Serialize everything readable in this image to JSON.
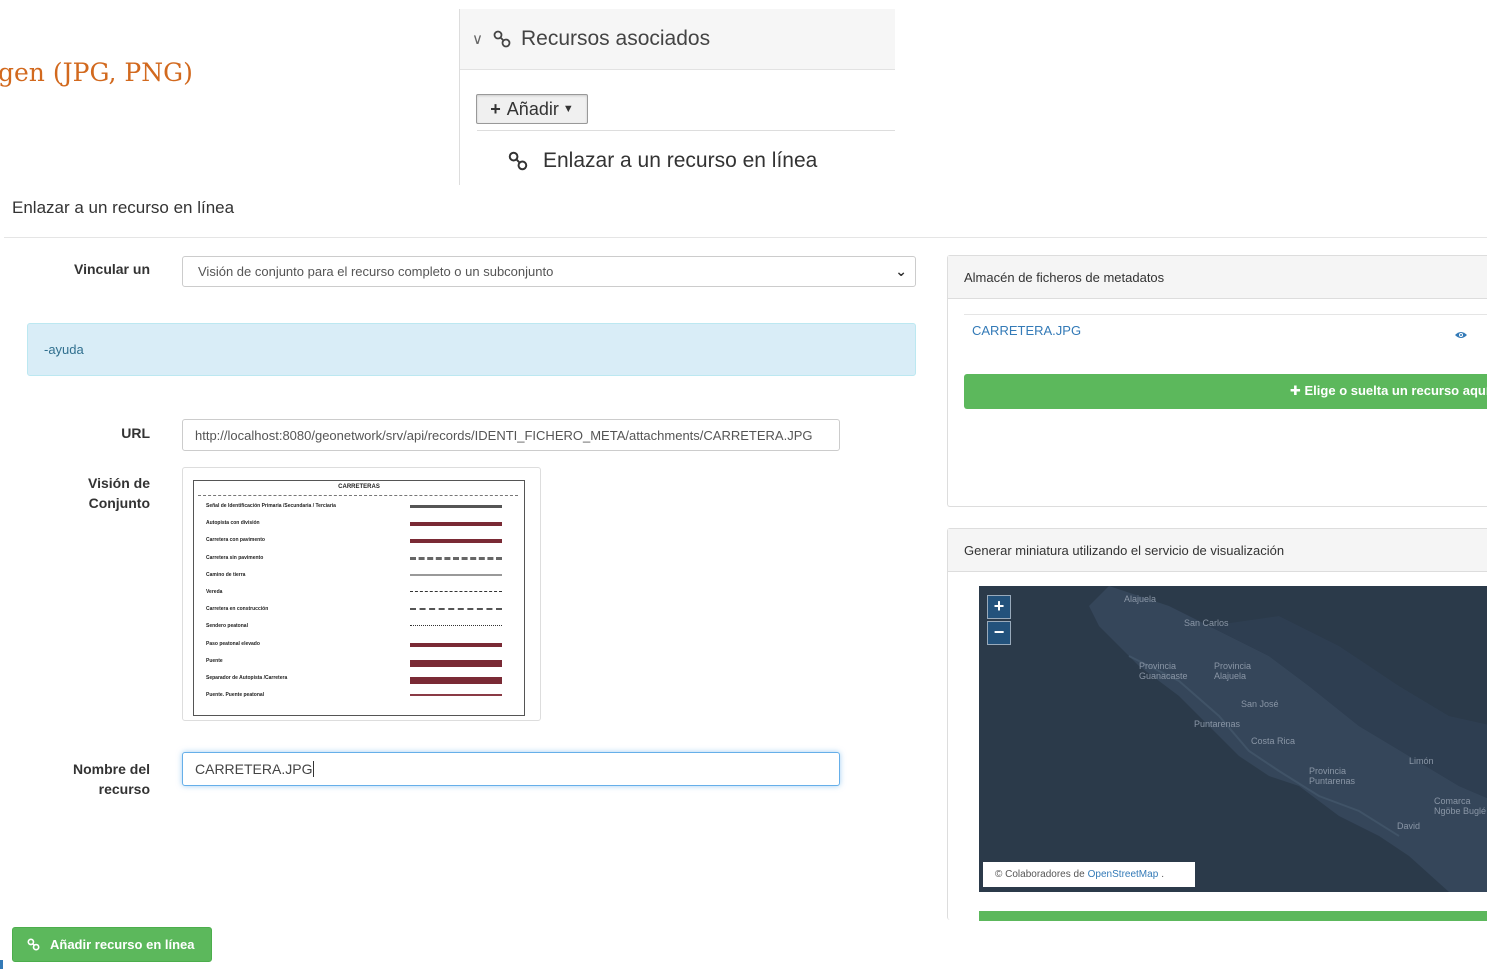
{
  "heading_fragment": "gen (JPG, PNG)",
  "associated": {
    "title": "Recursos asociados",
    "add_label": "Añadir",
    "menu_item": "Enlazar a un recurso en línea"
  },
  "dialog": {
    "title": "Enlazar a un recurso en línea",
    "link_label": "Vincular un",
    "link_select_value": "Visión de conjunto para el recurso completo o un subconjunto",
    "help_text": "-ayuda",
    "url_label": "URL",
    "url_value": "http://localhost:8080/geonetwork/srv/api/records/IDENTI_FICHERO_META/attachments/CARRETERA.JPG",
    "overview_label_1": "Visión de",
    "overview_label_2": "Conjunto",
    "name_label_1": "Nombre del",
    "name_label_2": "recurso",
    "name_value": "CARRETERA.JPG",
    "submit_label": "Añadir recurso en línea"
  },
  "thumbnail": {
    "title": "CARRETERAS",
    "rows": [
      "Señal de Identificación Primaria /Secundaria / Terciaria",
      "Autopista con división",
      "Carretera con pavimento",
      "Carretera sin pavimento",
      "Camino de tierra",
      "Vereda",
      "Carretera en construcción",
      "Sendero peatonal",
      "Paso peatonal elevado",
      "Puente",
      "Separador de Autopista /Carretera",
      "Puente. Puente peatonal"
    ]
  },
  "store": {
    "title": "Almacén de ficheros de metadatos",
    "file_name": "CARRETERA.JPG",
    "drop_label": "Elige o suelta un recurso aquí"
  },
  "thumbgen": {
    "title": "Generar miniatura utilizando el servicio de visualización",
    "zoom_in": "+",
    "zoom_out": "−",
    "attribution_prefix": "© Colaboradores de",
    "attribution_link": "OpenStreetMap",
    "attribution_suffix": ".",
    "map_labels": [
      "Alajuela",
      "Provincia Guanacaste",
      "San Carlos",
      "San José",
      "Costa Rica",
      "Puntarenas",
      "Provincia Puntarenas",
      "Limón",
      "David",
      "Comarca Ngöbe Buglé",
      "Provincia Alajuela"
    ]
  },
  "colors": {
    "accent_green": "#5cb85c",
    "link_blue": "#337ab7",
    "help_bg": "#d9edf7",
    "heading_orange": "#d2691e"
  }
}
